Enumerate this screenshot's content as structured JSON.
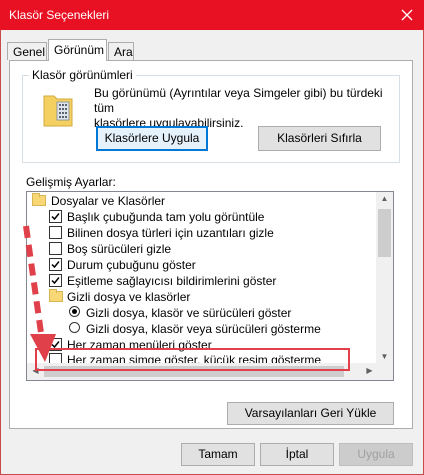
{
  "window": {
    "title": "Klasör Seçenekleri"
  },
  "tabs": [
    {
      "label": "Genel"
    },
    {
      "label": "Görünüm"
    },
    {
      "label": "Ara"
    }
  ],
  "folder_views": {
    "heading": "Klasör görünümleri",
    "line1": "Bu görünümü (Ayrıntılar veya Simgeler gibi) bu türdeki tüm",
    "line2": "klasörlere uygulayabilirsiniz.",
    "apply_label": "Klasörlere Uygula",
    "reset_label": "Klasörleri Sıfırla"
  },
  "advanced": {
    "heading": "Gelişmiş Ayarlar:",
    "items": [
      {
        "type": "folder",
        "label": "Dosyalar ve Klasörler"
      },
      {
        "type": "checkbox",
        "checked": true,
        "label": "Başlık çubuğunda tam yolu görüntüle"
      },
      {
        "type": "checkbox",
        "checked": false,
        "label": "Bilinen dosya türleri için uzantıları gizle"
      },
      {
        "type": "checkbox",
        "checked": false,
        "label": "Boş sürücüleri gizle"
      },
      {
        "type": "checkbox",
        "checked": true,
        "label": "Durum çubuğunu göster"
      },
      {
        "type": "checkbox",
        "checked": true,
        "label": "Eşitleme sağlayıcısı bildirimlerini göster"
      },
      {
        "type": "folder",
        "label": "Gizli dosya ve klasörler"
      },
      {
        "type": "radio",
        "checked": true,
        "label": "Gizli dosya, klasör ve sürücüleri göster"
      },
      {
        "type": "radio",
        "checked": false,
        "label": "Gizli dosya, klasör veya sürücüleri gösterme"
      },
      {
        "type": "checkbox",
        "checked": true,
        "label": "Her zaman menüleri göster"
      },
      {
        "type": "checkbox",
        "checked": false,
        "label": "Her zaman simge göster, küçük resim gösterme"
      }
    ],
    "restore_label": "Varsayılanları Geri Yükle"
  },
  "footer": {
    "ok_label": "Tamam",
    "cancel_label": "İptal",
    "apply_label": "Uygula"
  },
  "colors": {
    "titlebar": "#e81123",
    "highlight": "#e0404a",
    "accent": "#0078d7"
  }
}
